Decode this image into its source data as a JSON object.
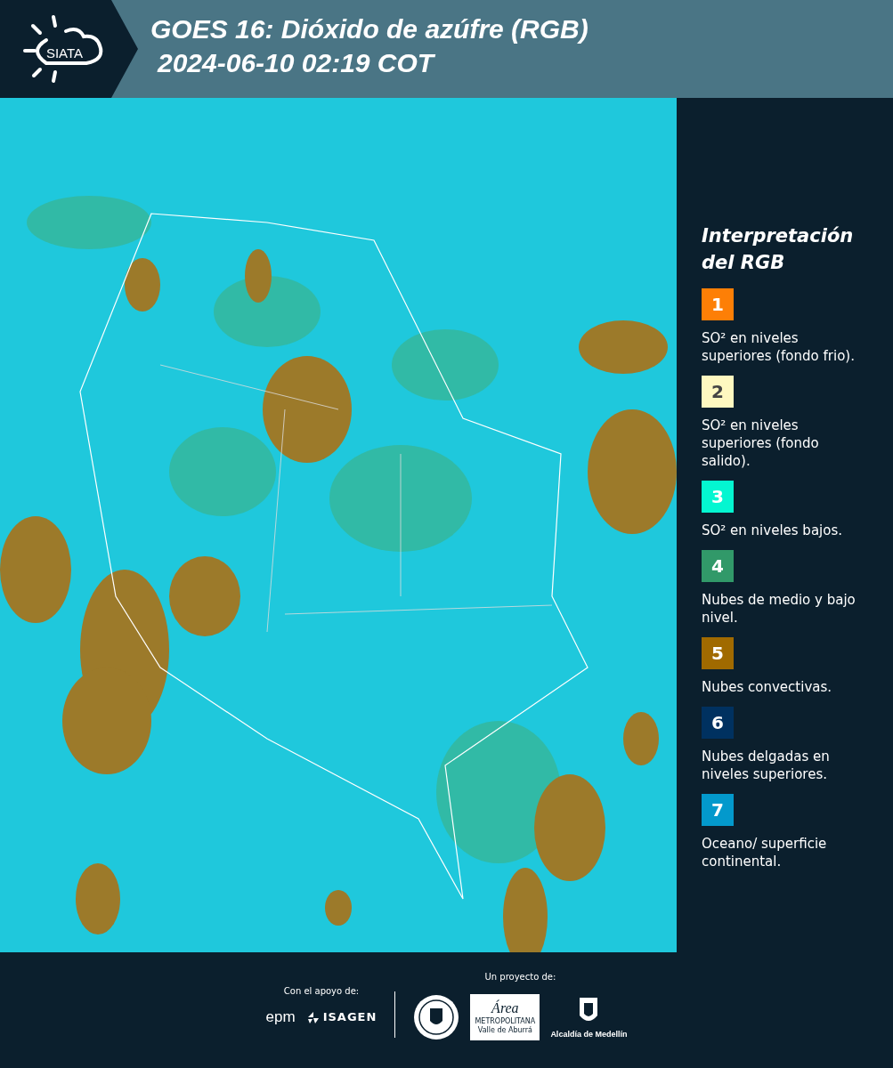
{
  "header": {
    "logo_text": "SIATA",
    "title": "GOES 16: Dióxido de azúfre (RGB)",
    "timestamp": "2024-06-10 02:19 COT"
  },
  "legend": {
    "title_lines": [
      "Interpretación",
      "del RGB"
    ],
    "items": [
      {
        "number": "1",
        "color": "#fd7f06",
        "text": "SO² en niveles superiores (fondo frio)."
      },
      {
        "number": "2",
        "color": "#fef8c0",
        "text": "SO² en niveles superiores (fondo salido)."
      },
      {
        "number": "3",
        "color": "#04f6d1",
        "text": "SO² en niveles bajos."
      },
      {
        "number": "4",
        "color": "#319969",
        "text": "Nubes de medio y bajo nivel."
      },
      {
        "number": "5",
        "color": "#a06a00",
        "text": "Nubes convectivas."
      },
      {
        "number": "6",
        "color": "#003160",
        "text": "Nubes delgadas en niveles superiores."
      },
      {
        "number": "7",
        "color": "#0399cc",
        "text": "Oceano/ superficie continental."
      }
    ]
  },
  "footer": {
    "support_label": "Con el apoyo de:",
    "project_label": "Un proyecto de:",
    "epm": "epm",
    "isagen": "ISAGEN",
    "area": "Área",
    "metropolitana": "METROPOLITANA",
    "valle": "Valle de Aburrá",
    "alcaldia": "Alcaldía de Medellín"
  }
}
